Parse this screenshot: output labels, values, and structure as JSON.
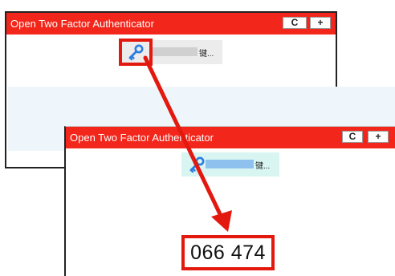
{
  "back_window": {
    "title": "Open Two Factor Authenticator",
    "refresh_icon": "refresh-icon",
    "refresh_glyph": "C",
    "add_glyph": "+",
    "entry": {
      "icon": "key-icon",
      "name": "键..."
    }
  },
  "front_window": {
    "title": "Open Two Factor Authenticator",
    "refresh_icon": "refresh-icon",
    "refresh_glyph": "C",
    "add_glyph": "+",
    "entry": {
      "icon": "key-icon",
      "name": "键..."
    },
    "otp_code": "066 474"
  },
  "colors": {
    "titlebar": "#f2261a",
    "annotation": "#e3180e",
    "key_icon": "#2a7de1",
    "selected_entry": "#d8f5f2"
  }
}
